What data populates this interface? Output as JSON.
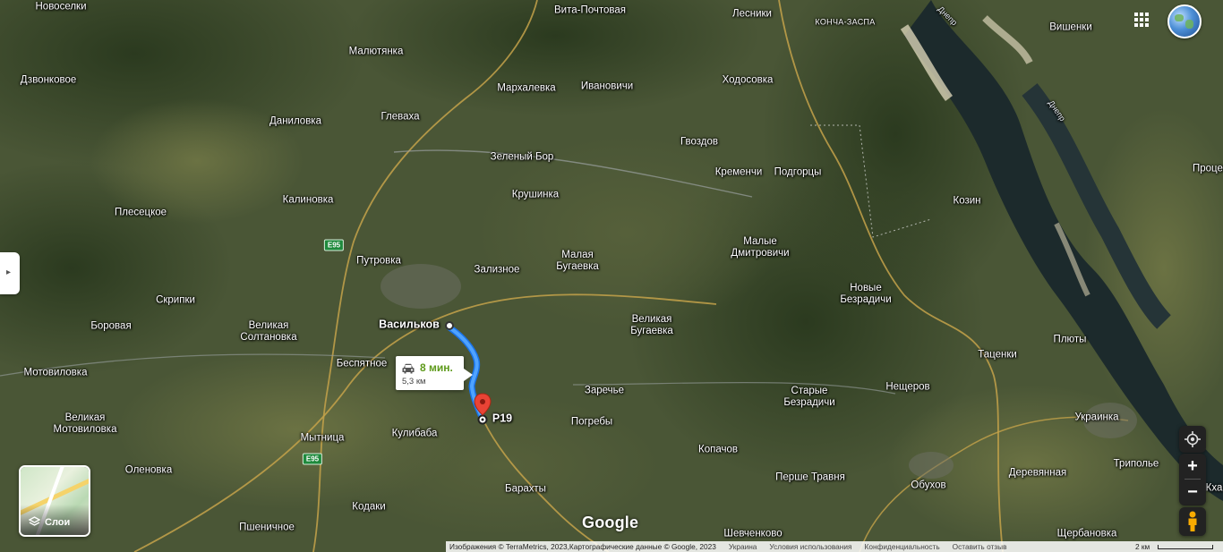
{
  "map": {
    "places": [
      {
        "name": "Новоселки"
      },
      {
        "name": "Дзвонковое"
      },
      {
        "name": "Малютянка"
      },
      {
        "name": "Вита-Почтовая"
      },
      {
        "name": "Лесники"
      },
      {
        "name": "КОНЧА-ЗАСПА"
      },
      {
        "name": "Вишенки"
      },
      {
        "name": "Мархалевка"
      },
      {
        "name": "Ивановичи"
      },
      {
        "name": "Ходосовка"
      },
      {
        "name": "Даниловка"
      },
      {
        "name": "Глеваха"
      },
      {
        "name": "Гвоздов"
      },
      {
        "name": "Зеленый Бор"
      },
      {
        "name": "Кременчи"
      },
      {
        "name": "Подгорцы"
      },
      {
        "name": "Процев"
      },
      {
        "name": "Калиновка"
      },
      {
        "name": "Крушинка"
      },
      {
        "name": "Козин"
      },
      {
        "name": "Плесецкое"
      },
      {
        "name": "Малые\nДмитровичи"
      },
      {
        "name": "Путровка"
      },
      {
        "name": "Малая\nБугаевка"
      },
      {
        "name": "Зализное"
      },
      {
        "name": "Скрипки"
      },
      {
        "name": "Новые\nБезрадичи"
      },
      {
        "name": "Боровая"
      },
      {
        "name": "Великая\nСолтановка"
      },
      {
        "name": "Васильков"
      },
      {
        "name": "Великая\nБугаевка"
      },
      {
        "name": "Плюты"
      },
      {
        "name": "Беспятное"
      },
      {
        "name": "Таценки"
      },
      {
        "name": "Мотовиловка"
      },
      {
        "name": "Нещеров"
      },
      {
        "name": "Заречье"
      },
      {
        "name": "Старые\nБезрадичи"
      },
      {
        "name": "Великая\nМотовиловка"
      },
      {
        "name": "Р19"
      },
      {
        "name": "Украинка"
      },
      {
        "name": "Погребы"
      },
      {
        "name": "Кулибаба"
      },
      {
        "name": "Мытница"
      },
      {
        "name": "Копачов"
      },
      {
        "name": "Оленовка"
      },
      {
        "name": "Перше Травня"
      },
      {
        "name": "Обухов"
      },
      {
        "name": "Деревянная"
      },
      {
        "name": "Триполье"
      },
      {
        "name": "Барахты"
      },
      {
        "name": "Кодаки"
      },
      {
        "name": "Пшеничное"
      },
      {
        "name": "Шевченково"
      },
      {
        "name": "Щербановка"
      },
      {
        "name": "Кха"
      }
    ],
    "rivers": [
      {
        "name": "Днепр"
      },
      {
        "name": "Днепр"
      }
    ],
    "road_shields": [
      {
        "label": "E95"
      },
      {
        "label": "E95"
      }
    ]
  },
  "route_box": {
    "time": "8 мин.",
    "distance": "5,3 км"
  },
  "layers_button": {
    "label": "Слои"
  },
  "logo": "Google",
  "controls": {
    "zoom_in": "+",
    "zoom_out": "−"
  },
  "footer": {
    "attribution": "Изображения © TerraMetrics, 2023,Картографические данные © Google, 2023",
    "country": "Украина",
    "terms": "Условия использования",
    "privacy": "Конфиденциальность",
    "feedback": "Оставить отзыв",
    "scale": "2 км"
  }
}
